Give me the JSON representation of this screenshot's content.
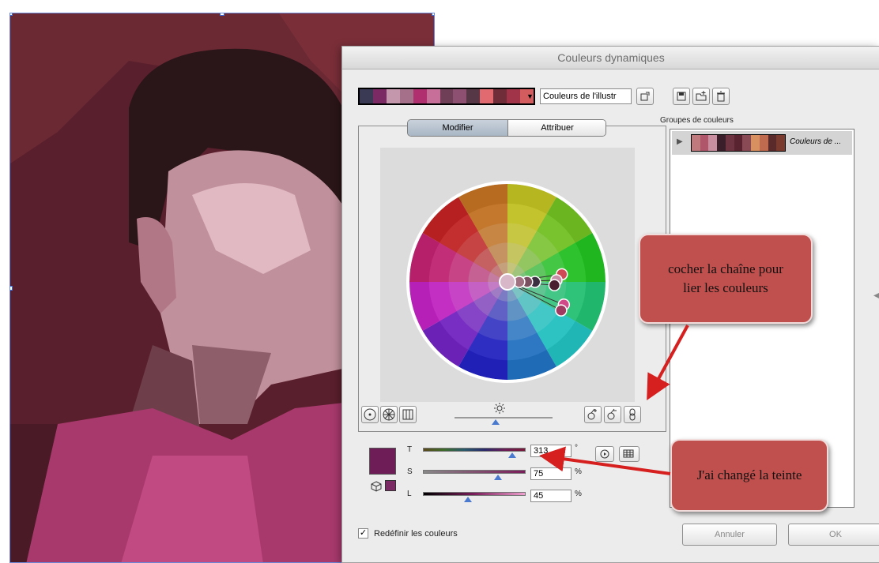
{
  "dialog": {
    "title": "Couleurs dynamiques",
    "harmony_name": "Couleurs de l'illustr",
    "tabs": {
      "modifier": "Modifier",
      "attribuer": "Attribuer"
    },
    "groups_label": "Groupes de couleurs",
    "group_item_name": "Couleurs de ...",
    "sliders": {
      "t_label": "T",
      "t_value": "313",
      "t_unit": "°",
      "s_label": "S",
      "s_value": "75",
      "s_unit": "%",
      "l_label": "L",
      "l_value": "45",
      "l_unit": "%"
    },
    "recolor_checkbox_label": "Redéfinir les couleurs",
    "cancel_label": "Annuler",
    "ok_label": "OK"
  },
  "harmony_swatches": [
    "#3a3a55",
    "#7b2a63",
    "#c497ac",
    "#a57089",
    "#b0306f",
    "#c86f99",
    "#6e3f56",
    "#8e5071",
    "#553746",
    "#e06a70",
    "#6f2d3a",
    "#a13448",
    "#d25c5e"
  ],
  "group_swatches": [
    "#c07a7d",
    "#b0566a",
    "#c98fa0",
    "#3a1f2a",
    "#6e3340",
    "#5a2330",
    "#8a4a55",
    "#d89060",
    "#c06a50",
    "#5a2a2a",
    "#7a3a2e"
  ],
  "selected_color": "#6e1d56",
  "callouts": {
    "chain": "cocher la chaîne pour lier les couleurs",
    "hue": "J'ai changé la teinte"
  },
  "icons": [
    "save-group-icon",
    "new-group-icon",
    "delete-group-icon",
    "eyedropper-icon",
    "add-color-tool-icon",
    "remove-color-tool-icon",
    "link-chain-icon",
    "brightness-icon",
    "color-mode-icon",
    "swatch-library-icon"
  ],
  "colors": {
    "accent": "#4a7ad0",
    "callout": "#c0504d"
  }
}
